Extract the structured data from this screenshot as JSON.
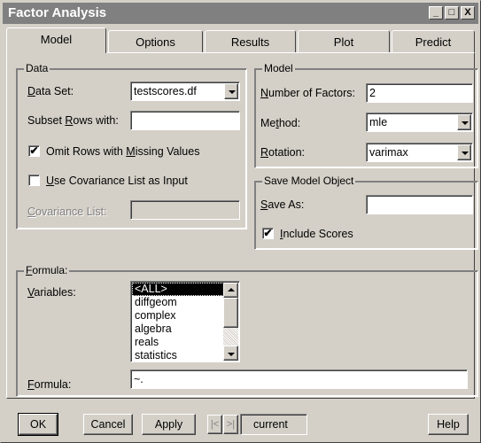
{
  "window": {
    "title": "Factor Analysis",
    "controls": {
      "minimize": "_",
      "maximize": "□",
      "close": "X"
    }
  },
  "tabs": [
    {
      "label": "Model",
      "active": true
    },
    {
      "label": "Options",
      "active": false
    },
    {
      "label": "Results",
      "active": false
    },
    {
      "label": "Plot",
      "active": false
    },
    {
      "label": "Predict",
      "active": false
    }
  ],
  "data_group": {
    "title": "Data",
    "data_set": {
      "label_pre": "",
      "label_key": "D",
      "label_post": "ata Set:",
      "value": "testscores.df"
    },
    "subset_rows": {
      "label_pre": "Subset ",
      "label_key": "R",
      "label_post": "ows with:",
      "value": ""
    },
    "omit_missing": {
      "label_pre": "Omit Rows with ",
      "label_key": "M",
      "label_post": "issing Values",
      "checked": true,
      "mark": "✔"
    },
    "use_covariance": {
      "label_pre": "",
      "label_key": "U",
      "label_post": "se Covariance List as Input",
      "checked": false,
      "mark": ""
    },
    "covariance_list": {
      "label_pre": "",
      "label_key": "C",
      "label_post": "ovariance List:",
      "value": "",
      "disabled": true
    }
  },
  "model_group": {
    "title": "Model",
    "num_factors": {
      "label_pre": "",
      "label_key": "N",
      "label_post": "umber of Factors:",
      "value": "2"
    },
    "method": {
      "label_pre": "Me",
      "label_key": "t",
      "label_post": "hod:",
      "value": "mle"
    },
    "rotation": {
      "label_pre": "",
      "label_key": "R",
      "label_post": "otation:",
      "value": "varimax"
    }
  },
  "save_group": {
    "title": "Save Model Object",
    "save_as": {
      "label_pre": "",
      "label_key": "S",
      "label_post": "ave As:",
      "value": ""
    },
    "include_scores": {
      "label_pre": "",
      "label_key": "I",
      "label_post": "nclude Scores",
      "checked": true,
      "mark": "✔"
    }
  },
  "formula_group": {
    "title_key": "F",
    "title_post": "ormula:",
    "variables_label_key": "V",
    "variables_label_post": "ariables:",
    "variables": [
      "<ALL>",
      "diffgeom",
      "complex",
      "algebra",
      "reals",
      "statistics"
    ],
    "selected_index": 0,
    "formula_label_key": "F",
    "formula_label_post": "ormula:",
    "formula_value": "~."
  },
  "buttons": {
    "ok": "OK",
    "cancel": "Cancel",
    "apply": "Apply",
    "prev": "|<",
    "next": ">|",
    "current": "current",
    "help": "Help"
  }
}
